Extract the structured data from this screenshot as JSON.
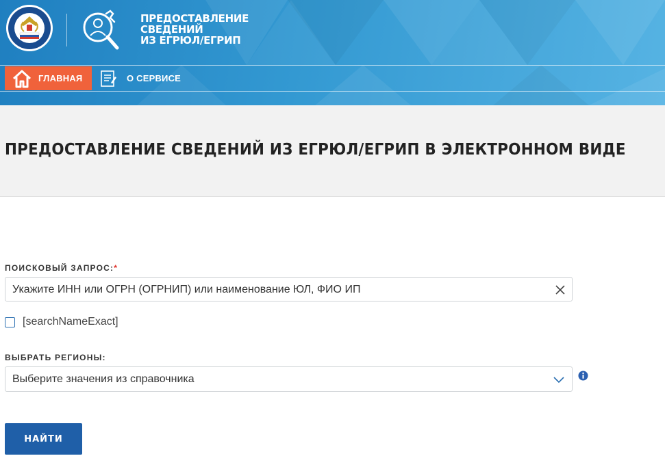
{
  "header": {
    "title_lines": [
      "ПРЕДОСТАВЛЕНИЕ",
      "СВЕДЕНИЙ",
      "ИЗ ЕГРЮЛ/ЕГРИП"
    ],
    "emblem_icon": "fns-emblem-icon",
    "service_icon": "search-person-wrench-icon"
  },
  "nav": {
    "home": {
      "label": "ГЛАВНАЯ",
      "icon": "home-icon",
      "active": true,
      "color": "#f0623b"
    },
    "about": {
      "label": "О СЕРВИСЕ",
      "icon": "document-icon"
    }
  },
  "page": {
    "title": "ПРЕДОСТАВЛЕНИЕ СВЕДЕНИЙ ИЗ ЕГРЮЛ/ЕГРИП В ЭЛЕКТРОННОМ ВИДЕ"
  },
  "form": {
    "query": {
      "label": "ПОИСКОВЫЙ ЗАПРОС:",
      "required_mark": "*",
      "placeholder": "Укажите ИНН или ОГРН (ОГРНИП) или наименование ЮЛ, ФИО ИП",
      "value": "",
      "clear_icon": "close-icon"
    },
    "exact_checkbox": {
      "label": "[searchNameExact]",
      "checked": false
    },
    "regions": {
      "label": "ВЫБРАТЬ РЕГИОНЫ:",
      "placeholder": "Выберите значения из справочника",
      "dropdown_icon": "chevron-down-icon",
      "info_icon": "info-icon"
    },
    "submit_label": "НАЙТИ"
  },
  "colors": {
    "header_blue": "#3399d2",
    "accent_orange": "#f0623b",
    "button_blue": "#1f5fa8",
    "required_red": "#e0312a"
  }
}
